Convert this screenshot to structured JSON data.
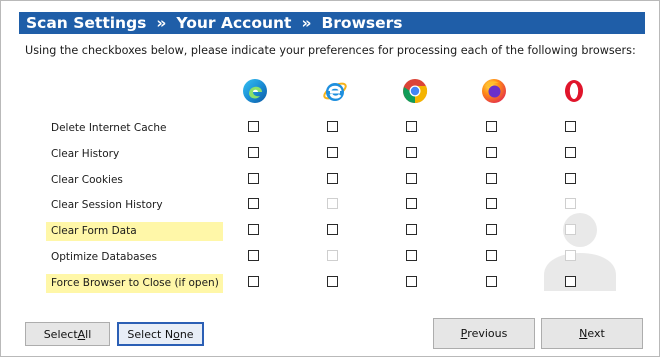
{
  "header": {
    "part1": "Scan Settings",
    "sep1": "»",
    "part2": "Your Account",
    "sep2": "»",
    "part3": "Browsers"
  },
  "intro_text": "Using the checkboxes below, please indicate your preferences for processing each of the following browsers:",
  "browsers": [
    {
      "icon": "edge-icon"
    },
    {
      "icon": "internet-explorer-icon"
    },
    {
      "icon": "chrome-icon"
    },
    {
      "icon": "firefox-icon"
    },
    {
      "icon": "opera-icon"
    }
  ],
  "rows": [
    {
      "label": "Delete Internet Cache",
      "highlight": false,
      "checks": [
        false,
        false,
        false,
        false,
        false
      ],
      "disabled": [
        false,
        false,
        false,
        false,
        false
      ]
    },
    {
      "label": "Clear History",
      "highlight": false,
      "checks": [
        false,
        false,
        false,
        false,
        false
      ],
      "disabled": [
        false,
        false,
        false,
        false,
        false
      ]
    },
    {
      "label": "Clear Cookies",
      "highlight": false,
      "checks": [
        false,
        false,
        false,
        false,
        false
      ],
      "disabled": [
        false,
        false,
        false,
        false,
        false
      ]
    },
    {
      "label": "Clear Session History",
      "highlight": false,
      "checks": [
        false,
        false,
        false,
        false,
        false
      ],
      "disabled": [
        false,
        true,
        false,
        false,
        true
      ]
    },
    {
      "label": "Clear Form Data",
      "highlight": true,
      "checks": [
        false,
        false,
        false,
        false,
        false
      ],
      "disabled": [
        false,
        false,
        false,
        false,
        true
      ]
    },
    {
      "label": "Optimize Databases",
      "highlight": false,
      "checks": [
        false,
        false,
        false,
        false,
        false
      ],
      "disabled": [
        false,
        true,
        false,
        false,
        true
      ]
    },
    {
      "label": "Force Browser to Close (if open)",
      "highlight": true,
      "checks": [
        false,
        false,
        false,
        false,
        false
      ],
      "disabled": [
        false,
        false,
        false,
        false,
        false
      ]
    }
  ],
  "buttons": {
    "select_all": {
      "pre": "Select ",
      "ul": "A",
      "post": "ll"
    },
    "select_none": {
      "pre": "Select N",
      "ul": "o",
      "post": "ne"
    },
    "previous": {
      "pre": "",
      "ul": "P",
      "post": "revious"
    },
    "next": {
      "pre": "",
      "ul": "N",
      "post": "ext"
    }
  },
  "colors": {
    "header_bg": "#1f5ea8",
    "highlight": "#fff7a8"
  }
}
